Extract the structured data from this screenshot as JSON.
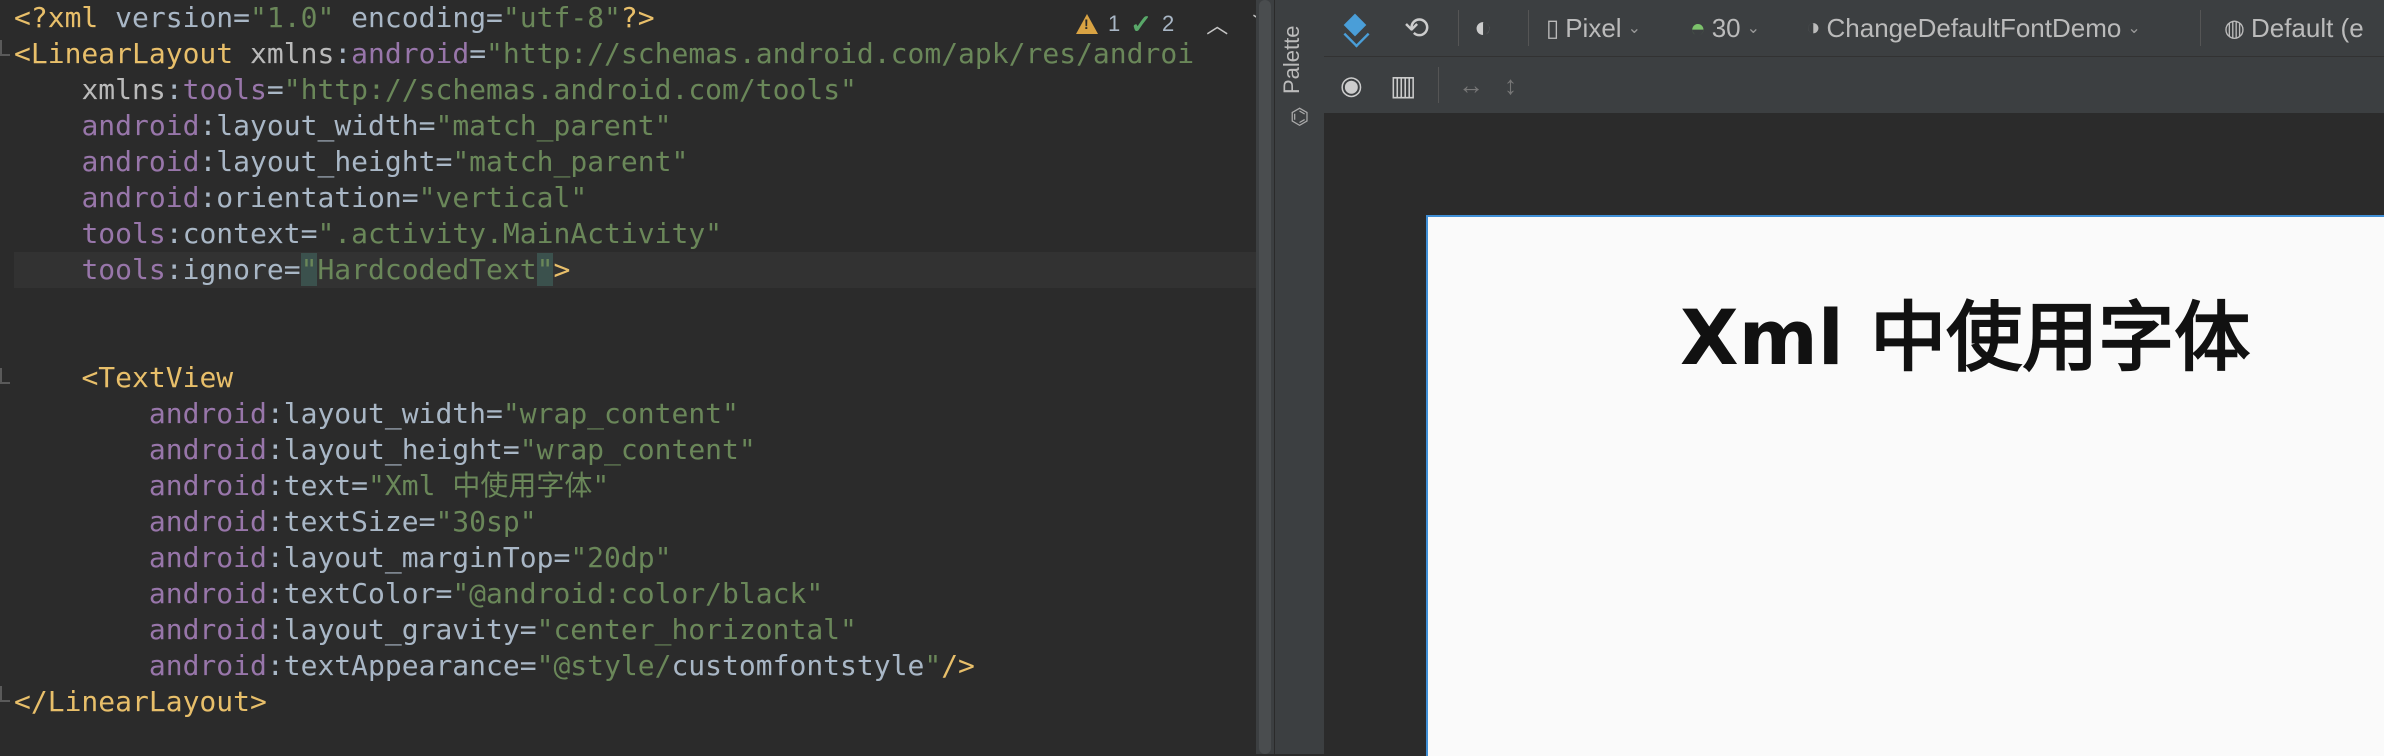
{
  "editor": {
    "lines": [
      [
        [
          "decl",
          "<?xml "
        ],
        [
          "plain",
          "version"
        ],
        [
          "plain",
          "="
        ],
        [
          "val",
          "\"1.0\""
        ],
        [
          "plain",
          " encoding"
        ],
        [
          "plain",
          "="
        ],
        [
          "val",
          "\"utf-8\""
        ],
        [
          "decl",
          "?>"
        ]
      ],
      [
        [
          "tag",
          "<LinearLayout "
        ],
        [
          "attr",
          "xmlns"
        ],
        [
          "plain",
          ":"
        ],
        [
          "ns",
          "android"
        ],
        [
          "plain",
          "="
        ],
        [
          "val",
          "\"http://schemas.android.com/apk/res/androi"
        ]
      ],
      [
        [
          "plain",
          "    "
        ],
        [
          "attr",
          "xmlns"
        ],
        [
          "plain",
          ":"
        ],
        [
          "ns",
          "tools"
        ],
        [
          "plain",
          "="
        ],
        [
          "val",
          "\"http://schemas.android.com/tools\""
        ]
      ],
      [
        [
          "plain",
          "    "
        ],
        [
          "ns",
          "android"
        ],
        [
          "plain",
          ":layout_width="
        ],
        [
          "val",
          "\"match_parent\""
        ]
      ],
      [
        [
          "plain",
          "    "
        ],
        [
          "ns",
          "android"
        ],
        [
          "plain",
          ":layout_height="
        ],
        [
          "val",
          "\"match_parent\""
        ]
      ],
      [
        [
          "plain",
          "    "
        ],
        [
          "ns",
          "android"
        ],
        [
          "plain",
          ":orientation="
        ],
        [
          "val",
          "\"vertical\""
        ]
      ],
      [
        [
          "plain",
          "    "
        ],
        [
          "ns",
          "tools"
        ],
        [
          "plain",
          ":context="
        ],
        [
          "val",
          "\".activity.MainActivity\""
        ]
      ],
      [
        [
          "plain",
          "    "
        ],
        [
          "ns",
          "tools"
        ],
        [
          "plain",
          ":ignore="
        ],
        [
          "hl",
          "\""
        ],
        [
          "val",
          "HardcodedText"
        ],
        [
          "hl",
          "\""
        ],
        [
          "tag",
          ">"
        ]
      ],
      [],
      [],
      [
        [
          "plain",
          "    "
        ],
        [
          "tag",
          "<TextView"
        ]
      ],
      [
        [
          "plain",
          "        "
        ],
        [
          "ns",
          "android"
        ],
        [
          "plain",
          ":layout_width="
        ],
        [
          "val",
          "\"wrap_content\""
        ]
      ],
      [
        [
          "plain",
          "        "
        ],
        [
          "ns",
          "android"
        ],
        [
          "plain",
          ":layout_height="
        ],
        [
          "val",
          "\"wrap_content\""
        ]
      ],
      [
        [
          "plain",
          "        "
        ],
        [
          "ns",
          "android"
        ],
        [
          "plain",
          ":text="
        ],
        [
          "val",
          "\"Xml 中使用字体\""
        ]
      ],
      [
        [
          "plain",
          "        "
        ],
        [
          "ns",
          "android"
        ],
        [
          "plain",
          ":textSize="
        ],
        [
          "val",
          "\"30sp\""
        ]
      ],
      [
        [
          "plain",
          "        "
        ],
        [
          "ns",
          "android"
        ],
        [
          "plain",
          ":layout_marginTop="
        ],
        [
          "val",
          "\"20dp\""
        ]
      ],
      [
        [
          "plain",
          "        "
        ],
        [
          "ns",
          "android"
        ],
        [
          "plain",
          ":textColor="
        ],
        [
          "val",
          "\"@android:color/black\""
        ]
      ],
      [
        [
          "plain",
          "        "
        ],
        [
          "ns",
          "android"
        ],
        [
          "plain",
          ":layout_gravity="
        ],
        [
          "val",
          "\"center_horizontal\""
        ]
      ],
      [
        [
          "plain",
          "        "
        ],
        [
          "ns",
          "android"
        ],
        [
          "plain",
          ":textAppearance="
        ],
        [
          "val",
          "\"@style/"
        ],
        [
          "squig",
          "customfontstyle"
        ],
        [
          "val",
          "\""
        ],
        [
          "tag",
          "/>"
        ]
      ],
      [
        [
          "tag",
          "</LinearLayout>"
        ]
      ]
    ],
    "warnings_count": "1",
    "weak_warnings_count": "2"
  },
  "palette": {
    "label": "Palette"
  },
  "toolbar": {
    "device": "Pixel",
    "api_level": "30",
    "theme": "ChangeDefaultFontDemo",
    "locale": "Default (e"
  },
  "preview": {
    "text": "Xml 中使用字体"
  },
  "colors": {
    "accent": "#3f8fd6",
    "editor_bg": "#2b2b2b",
    "panel_bg": "#3c3f41"
  }
}
